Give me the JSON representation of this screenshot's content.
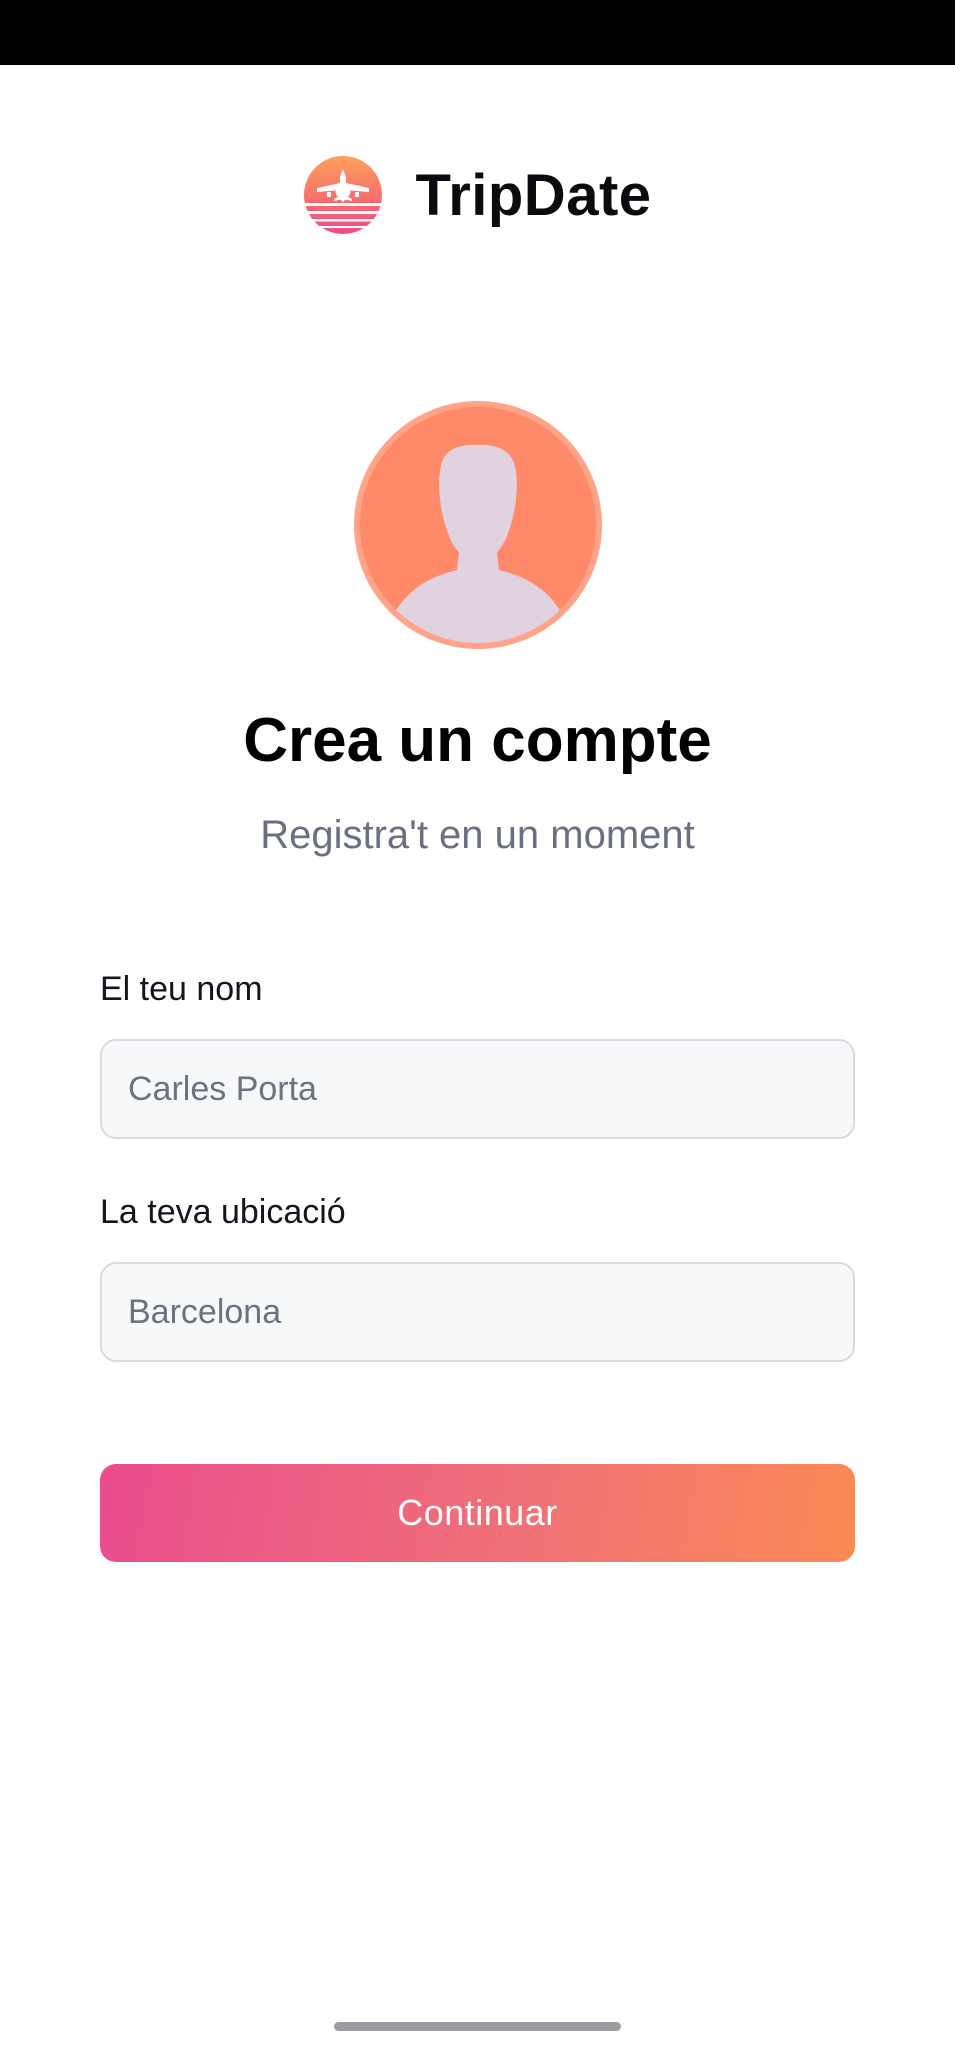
{
  "app": {
    "name": "TripDate"
  },
  "header": {
    "title": "Crea un compte",
    "subtitle": "Registra't en un moment"
  },
  "form": {
    "name": {
      "label": "El teu nom",
      "placeholder": "Carles Porta",
      "value": ""
    },
    "location": {
      "label": "La teva ubicació",
      "placeholder": "Barcelona",
      "value": ""
    },
    "submit_label": "Continuar"
  },
  "icons": {
    "logo": "plane-heart-sunset-logo",
    "avatar": "default-user-avatar"
  },
  "colors": {
    "gradient_start": "#e94d8d",
    "gradient_end": "#fb8a55",
    "avatar_bg": "#ff8a6a",
    "text_primary": "#000000",
    "text_secondary": "#6b7080"
  }
}
